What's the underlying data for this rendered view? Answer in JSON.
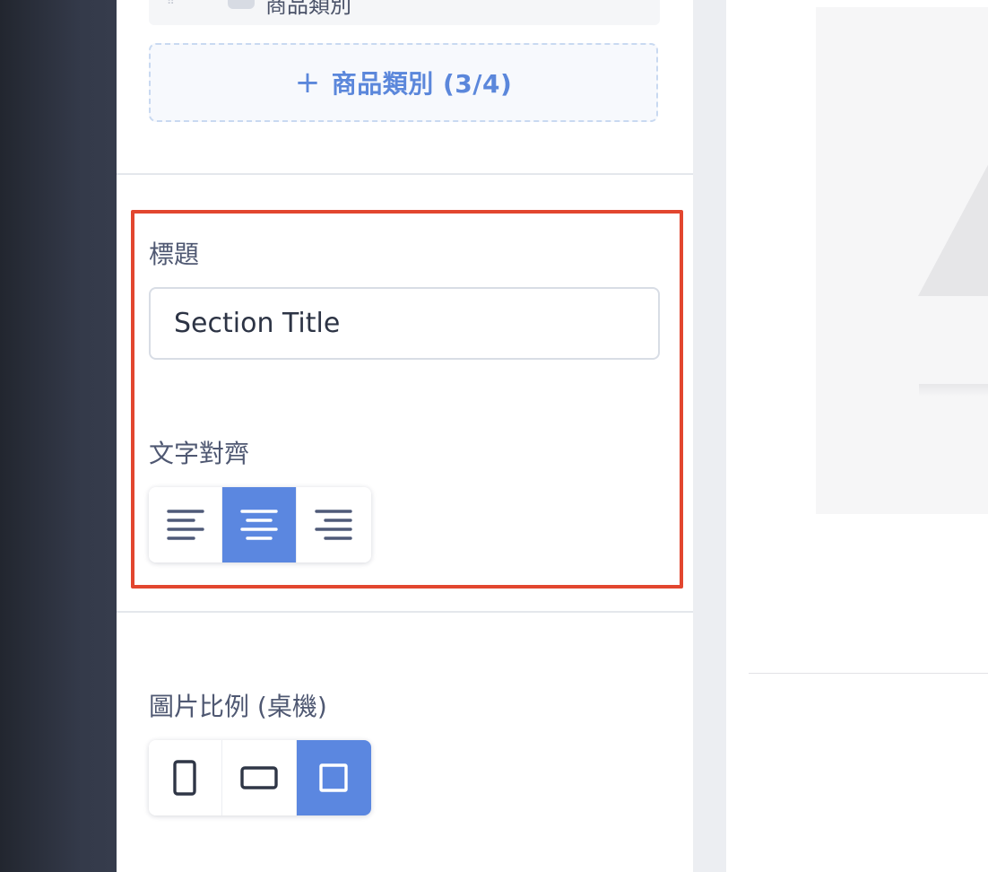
{
  "category_list": {
    "cutoff_item_label": "商品類別",
    "add_category_label": "商品類別 (3/4)"
  },
  "title_field": {
    "label": "標題",
    "value": "Section Title"
  },
  "text_align": {
    "label": "文字對齊",
    "options": [
      "left",
      "center",
      "right"
    ],
    "selected": "center"
  },
  "image_ratio": {
    "label": "圖片比例 (桌機)",
    "options": [
      "portrait",
      "landscape",
      "square"
    ],
    "selected": "square"
  },
  "colors": {
    "accent": "#5b87e0",
    "highlight_border": "#e2462f",
    "sidebar": "#343a4a"
  }
}
